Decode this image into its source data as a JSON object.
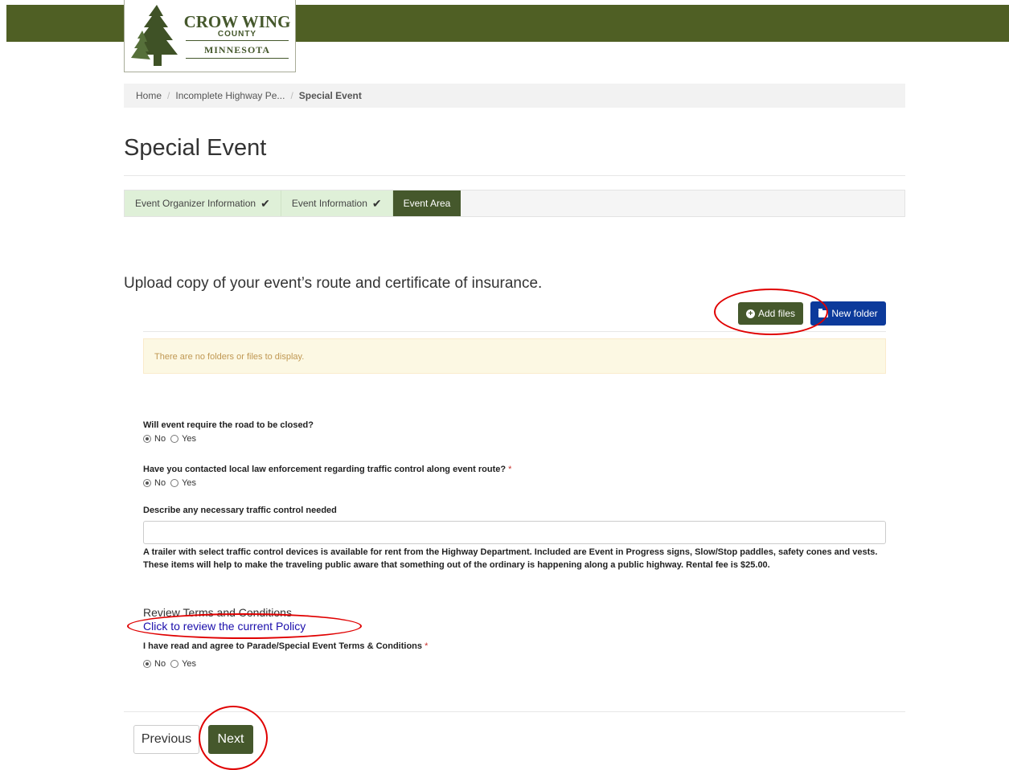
{
  "logo": {
    "line1": "CROW WING",
    "line2": "COUNTY",
    "line3": "MINNESOTA"
  },
  "breadcrumb": {
    "home": "Home",
    "parent": "Incomplete Highway Pe...",
    "current": "Special Event"
  },
  "page": {
    "title": "Special Event"
  },
  "steps": [
    {
      "label": "Event Organizer Information",
      "state": "done"
    },
    {
      "label": "Event Information",
      "state": "done"
    },
    {
      "label": "Event Area",
      "state": "active"
    }
  ],
  "upload": {
    "heading": "Upload copy of your event’s route and certificate of insurance.",
    "add_files_label": "Add files",
    "new_folder_label": "New folder",
    "empty_message": "There are no folders or files to display."
  },
  "questions": {
    "road_closed": {
      "label": "Will event require the road to be closed?",
      "options": [
        "No",
        "Yes"
      ],
      "selected": "No"
    },
    "law_enforcement": {
      "label": "Have you contacted local law enforcement regarding traffic control along event route?",
      "required_mark": "*",
      "options": [
        "No",
        "Yes"
      ],
      "selected": "No"
    },
    "traffic_control": {
      "label": "Describe any necessary traffic control needed",
      "value": ""
    },
    "note": "A trailer with select traffic control devices is available for rent from the Highway Department. Included are Event in Progress signs, Slow/Stop paddles, safety cones and vests. These items will help to make the traveling public aware that something out of the ordinary is happening along a public highway.  Rental fee is $25.00.",
    "terms": {
      "section_title": "Review Terms and Conditions",
      "link_text": "Click to review the current Policy",
      "label": "I have read and agree to Parade/Special Event Terms & Conditions",
      "required_mark": "*",
      "options": [
        "No",
        "Yes"
      ],
      "selected": "No"
    }
  },
  "nav": {
    "previous_label": "Previous",
    "next_label": "Next"
  },
  "colors": {
    "brand_green": "#45582c",
    "header_green": "#4f5f24",
    "new_folder_blue": "#0c3a9b",
    "link_blue": "#1a0dab",
    "annotation_red": "#e00000"
  },
  "icons": {
    "check": "check-icon",
    "add": "plus-circle-icon",
    "folder": "folder-icon",
    "tree": "pine-tree-icon"
  }
}
